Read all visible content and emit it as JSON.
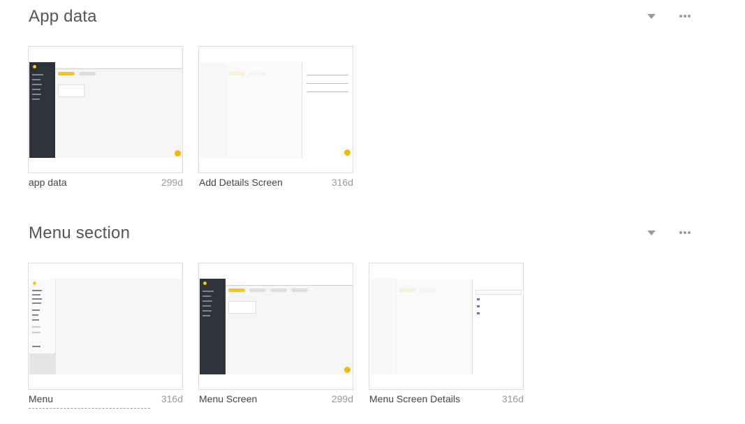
{
  "sections": [
    {
      "title": "App data",
      "icons": {
        "collapse": "chevron-down-icon",
        "more": "more-horizontal-icon"
      },
      "cards": [
        {
          "name": "app data",
          "age": "299d"
        },
        {
          "name": "Add Details Screen",
          "age": "316d"
        }
      ]
    },
    {
      "title": "Menu section",
      "icons": {
        "collapse": "chevron-down-icon",
        "more": "more-horizontal-icon"
      },
      "cards": [
        {
          "name": "Menu",
          "age": "316d"
        },
        {
          "name": "Menu Screen",
          "age": "299d"
        },
        {
          "name": "Menu Screen Details",
          "age": "316d"
        }
      ]
    }
  ],
  "colors": {
    "accent": "#f5c518",
    "sidebar": "#2d3339",
    "text": "#555555",
    "muted": "#9a9a9a"
  }
}
